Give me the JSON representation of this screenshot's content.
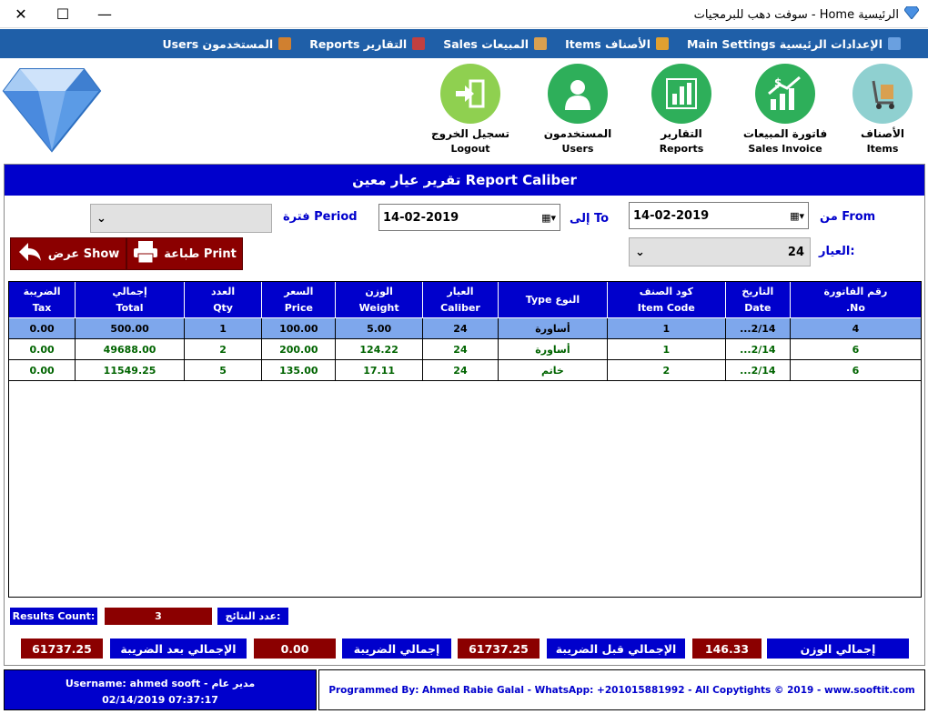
{
  "window": {
    "title": "الرئيسية Home - سوفت دهب للبرمجيات",
    "controls": {
      "minimize": "—",
      "maximize": "☐",
      "close": "✕"
    }
  },
  "menu": {
    "items": [
      {
        "label": "الإعدادات الرئيسية Main Settings",
        "icon": "settings-icon",
        "color": "#6aa0e0"
      },
      {
        "label": "الأصناف Items",
        "icon": "cart-icon",
        "color": "#e0a030"
      },
      {
        "label": "المبيعات Sales",
        "icon": "box-icon",
        "color": "#d9a050"
      },
      {
        "label": "التقارير Reports",
        "icon": "chart-icon",
        "color": "#c04040"
      },
      {
        "label": "المستخدمون Users",
        "icon": "users-icon",
        "color": "#d08030"
      }
    ]
  },
  "toolbar": {
    "items": [
      {
        "ar": "الأصناف",
        "en": "Items",
        "icon": "trolley-icon",
        "color": "#8fd0d0"
      },
      {
        "ar": "فاتورة المبيعات",
        "en": "Sales Invoice",
        "icon": "growth-chart-icon",
        "color": "#2eaf5a"
      },
      {
        "ar": "التقارير",
        "en": "Reports",
        "icon": "bar-chart-icon",
        "color": "#2eaf5a"
      },
      {
        "ar": "المستخدمون",
        "en": "Users",
        "icon": "user-icon",
        "color": "#2eaf5a"
      },
      {
        "ar": "تسجيل الخروج",
        "en": "Logout",
        "icon": "logout-icon",
        "color": "#8fd050"
      }
    ]
  },
  "report": {
    "title": "تقرير عيار معين  Report Caliber",
    "from_label": "من From",
    "from_value": "14-02-2019",
    "to_label": "إلى To",
    "to_value": "14-02-2019",
    "period_label": "فترة Period",
    "period_value": "",
    "caliber_label": "العيار:",
    "caliber_value": "24",
    "show_button": "عرض Show",
    "print_button": "طباعة Print"
  },
  "table": {
    "columns": [
      {
        "ar": "رقم الفاتورة",
        "en": "No."
      },
      {
        "ar": "التاريخ",
        "en": "Date"
      },
      {
        "ar": "كود الصنف",
        "en": "Item Code"
      },
      {
        "ar": "النوع",
        "en": "Type"
      },
      {
        "ar": "العيار",
        "en": "Caliber"
      },
      {
        "ar": "الوزن",
        "en": "Weight"
      },
      {
        "ar": "السعر",
        "en": "Price"
      },
      {
        "ar": "العدد",
        "en": "Qty"
      },
      {
        "ar": "إجمالي",
        "en": "Total"
      },
      {
        "ar": "الضريبة",
        "en": "Tax"
      }
    ],
    "rows": [
      [
        "4",
        "2/14...",
        "1",
        "أساورة",
        "24",
        "5.00",
        "100.00",
        "1",
        "500.00",
        "0.00"
      ],
      [
        "6",
        "2/14...",
        "1",
        "أساورة",
        "24",
        "124.22",
        "200.00",
        "2",
        "49688.00",
        "0.00"
      ],
      [
        "6",
        "2/14...",
        "2",
        "خاتم",
        "24",
        "17.11",
        "135.00",
        "5",
        "11549.25",
        "0.00"
      ]
    ]
  },
  "results": {
    "count_label_en": "Results Count:",
    "count_value": "3",
    "count_label_ar": "عدد النتائج:"
  },
  "totals": {
    "weight_label": "إجمالي الوزن",
    "weight_value": "146.33",
    "before_tax_label": "الإجمالي قبل الضريبة",
    "before_tax_value": "61737.25",
    "tax_label": "إجمالي الضريبة",
    "tax_value": "0.00",
    "after_tax_label": "الإجمالي بعد الضريبة",
    "after_tax_value": "61737.25"
  },
  "footer": {
    "username": "Username: ahmed sooft - مدير عام",
    "datetime": "02/14/2019 07:37:17",
    "credits": "Programmed By: Ahmed Rabie Galal - WhatsApp: +201015881992 - All Copytights © 2019 - www.sooftit.com"
  }
}
